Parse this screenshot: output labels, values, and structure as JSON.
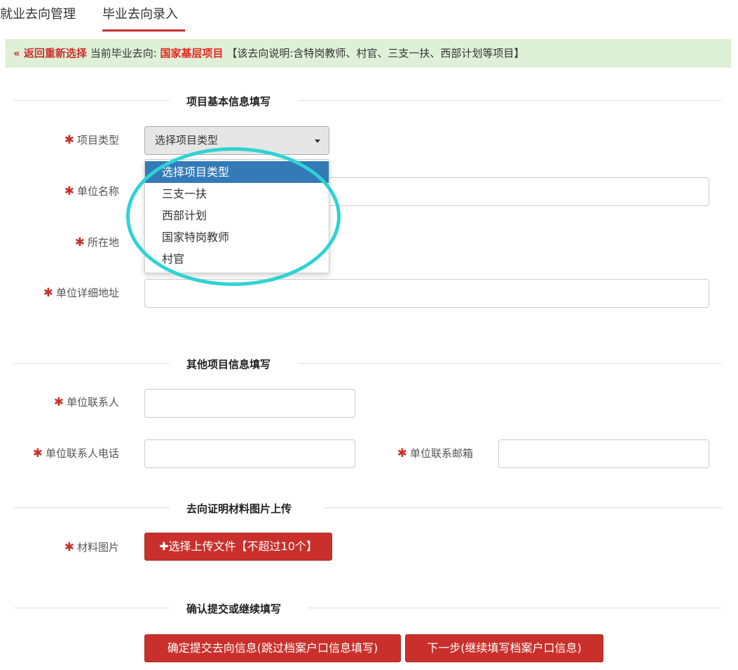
{
  "tabs": [
    {
      "label": "就业去向管理",
      "active": false
    },
    {
      "label": "毕业去向录入",
      "active": true
    }
  ],
  "notice": {
    "back_link": "« 返回重新选择",
    "current_label": "当前毕业去向:",
    "destination": "国家基层项目",
    "description": "【该去向说明:含特岗教师、村官、三支一扶、西部计划等项目】"
  },
  "sections": {
    "basic": "项目基本信息填写",
    "other": "其他项目信息填写",
    "upload": "去向证明材料图片上传",
    "confirm": "确认提交或继续填写"
  },
  "required_mark": "✱",
  "fields": {
    "project_type": {
      "label": "项目类型",
      "selected": "选择项目类型",
      "options": [
        "选择项目类型",
        "三支一扶",
        "西部计划",
        "国家特岗教师",
        "村官"
      ],
      "open": true
    },
    "unit_name": {
      "label": "单位名称",
      "value": ""
    },
    "location": {
      "label": "所在地",
      "value": ""
    },
    "unit_address": {
      "label": "单位详细地址",
      "value": ""
    },
    "contact": {
      "label": "单位联系人",
      "value": ""
    },
    "contact_phone": {
      "label": "单位联系人电话",
      "value": ""
    },
    "contact_email": {
      "label": "单位联系邮箱",
      "value": ""
    },
    "material_images": {
      "label": "材料图片"
    }
  },
  "buttons": {
    "upload": "✚选择上传文件【不超过10个】",
    "submit": "确定提交去向信息(跳过档案户口信息填写)",
    "next": "下一步(继续填写档案户口信息)"
  },
  "colors": {
    "accent_red": "#c9302c",
    "notice_bg": "#dff0d8",
    "highlight_blue": "#337ab7",
    "annotation_cyan": "#2ed3d5"
  }
}
